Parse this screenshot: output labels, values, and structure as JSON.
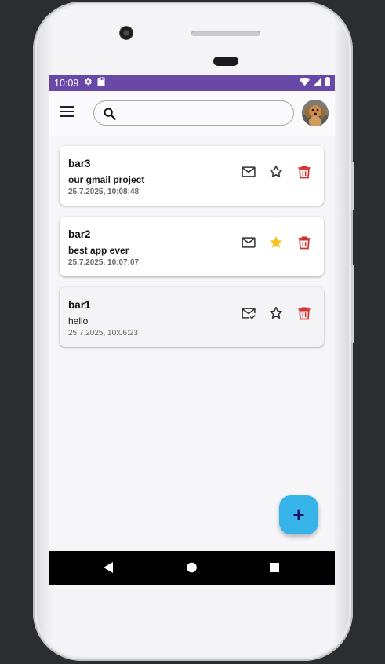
{
  "statusbar": {
    "time": "10:09",
    "bg_color": "#6949a8",
    "icons": [
      "gear-icon",
      "sd-card-icon",
      "wifi-icon",
      "signal-icon",
      "battery-icon"
    ]
  },
  "appbar": {
    "menu_icon": "hamburger-menu-icon",
    "search": {
      "icon": "search-icon",
      "placeholder": "",
      "value": ""
    },
    "avatar": "puppy-avatar"
  },
  "messages": [
    {
      "title": "bar3",
      "body": "our gmail project",
      "date": "25.7.2025, 10:08:48",
      "read": false,
      "starred": false
    },
    {
      "title": "bar2",
      "body": "best app ever",
      "date": "25.7.2025, 10:07:07",
      "read": false,
      "starred": true
    },
    {
      "title": "bar1",
      "body": "hello",
      "date": "25.7.2025, 10:06:23",
      "read": true,
      "starred": false
    }
  ],
  "fab": {
    "label": "+",
    "color": "#36b3e9"
  },
  "colors": {
    "delete": "#d32f2f",
    "star_active": "#f7c21a"
  },
  "navbar": {
    "buttons": [
      "back-icon",
      "home-icon",
      "recents-icon"
    ]
  }
}
